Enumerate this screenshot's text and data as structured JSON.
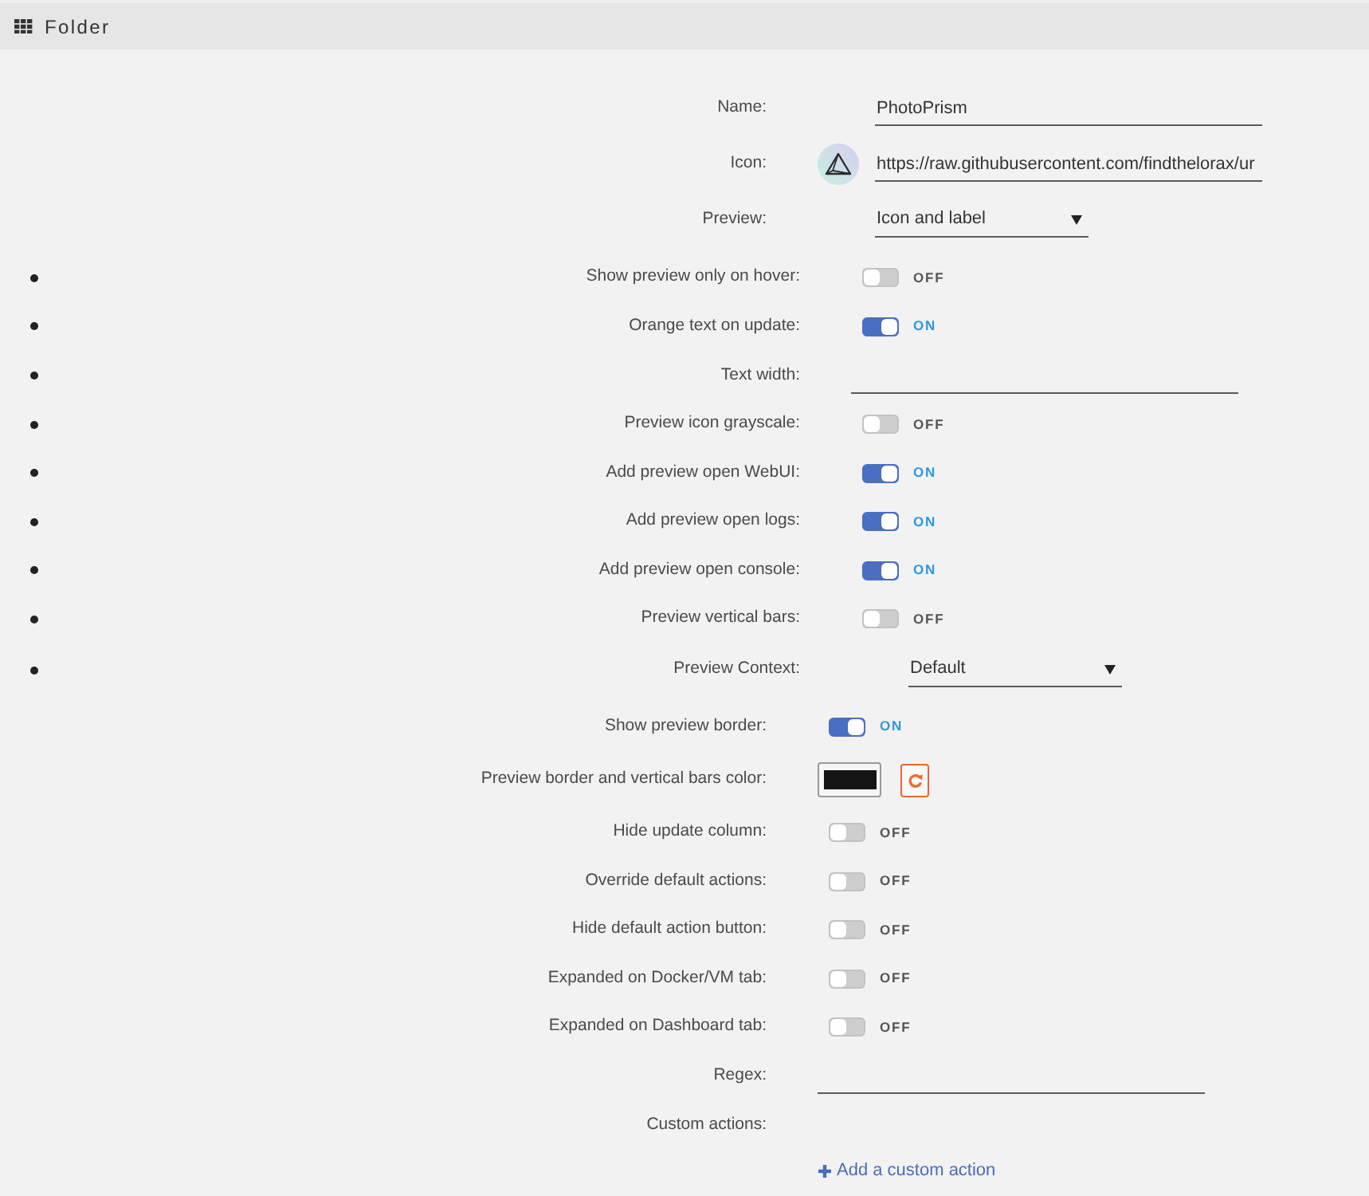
{
  "header": {
    "title": "Folder"
  },
  "name": {
    "label": "Name:",
    "value": "PhotoPrism"
  },
  "icon": {
    "label": "Icon:",
    "value": "https://raw.githubusercontent.com/findthelorax/ur"
  },
  "preview": {
    "label": "Preview:",
    "value": "Icon and label",
    "children": [
      {
        "kind": "toggle",
        "label": "Show preview only on hover:",
        "on": false,
        "state_text": "OFF"
      },
      {
        "kind": "toggle",
        "label": "Orange text on update:",
        "on": true,
        "state_text": "ON"
      },
      {
        "kind": "text",
        "label": "Text width:"
      },
      {
        "kind": "toggle",
        "label": "Preview icon grayscale:",
        "on": false,
        "state_text": "OFF"
      },
      {
        "kind": "toggle",
        "label": "Add preview open WebUI:",
        "on": true,
        "state_text": "ON"
      },
      {
        "kind": "toggle",
        "label": "Add preview open logs:",
        "on": true,
        "state_text": "ON"
      },
      {
        "kind": "toggle",
        "label": "Add preview open console:",
        "on": true,
        "state_text": "ON"
      },
      {
        "kind": "toggle",
        "label": "Preview vertical bars:",
        "on": false,
        "state_text": "OFF"
      },
      {
        "kind": "select",
        "label": "Preview Context:",
        "value": "Default"
      }
    ]
  },
  "settings": [
    {
      "kind": "toggle",
      "label": "Show preview border:",
      "on": true,
      "state_text": "ON"
    },
    {
      "kind": "color",
      "label": "Preview border and vertical bars color:",
      "color": "#141414"
    },
    {
      "kind": "toggle",
      "label": "Hide update column:",
      "on": false,
      "state_text": "OFF"
    },
    {
      "kind": "toggle",
      "label": "Override default actions:",
      "on": false,
      "state_text": "OFF"
    },
    {
      "kind": "toggle",
      "label": "Hide default action button:",
      "on": false,
      "state_text": "OFF"
    },
    {
      "kind": "toggle",
      "label": "Expanded on Docker/VM tab:",
      "on": false,
      "state_text": "OFF"
    },
    {
      "kind": "toggle",
      "label": "Expanded on Dashboard tab:",
      "on": false,
      "state_text": "OFF"
    },
    {
      "kind": "text",
      "label": "Regex:"
    }
  ],
  "custom_actions": {
    "label": "Custom actions:",
    "add_link": "Add a custom action"
  }
}
